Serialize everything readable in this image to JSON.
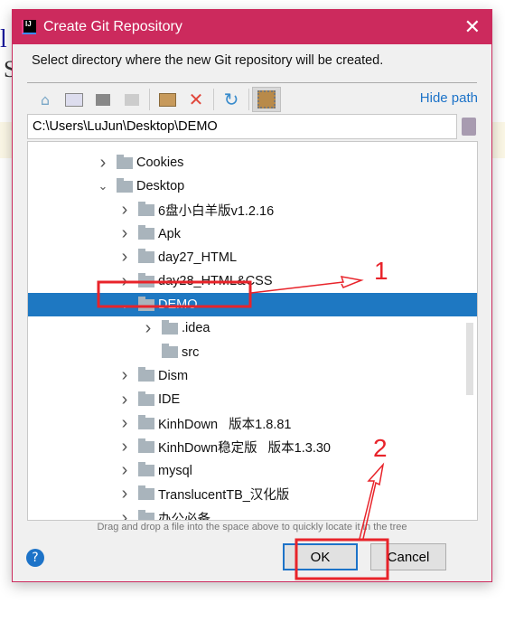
{
  "window": {
    "title": "Create Git Repository",
    "description": "Select directory where the new Git repository will be created."
  },
  "toolbar": {
    "icons": [
      "home-icon",
      "desktop-icon",
      "project-folder-icon",
      "module-folder-icon",
      "new-folder-icon",
      "delete-icon",
      "refresh-icon",
      "show-hidden-icon"
    ],
    "hide_path": "Hide path"
  },
  "path": {
    "value": "C:\\Users\\LuJun\\Desktop\\DEMO"
  },
  "tree": [
    {
      "label": "Cookies",
      "level": 1,
      "expanded": false,
      "has_children": true
    },
    {
      "label": "Desktop",
      "level": 1,
      "expanded": true,
      "has_children": true
    },
    {
      "label": "6盘小白羊版v1.2.16",
      "level": 2,
      "expanded": false,
      "has_children": true
    },
    {
      "label": "Apk",
      "level": 2,
      "expanded": false,
      "has_children": true
    },
    {
      "label": "day27_HTML",
      "level": 2,
      "expanded": false,
      "has_children": true
    },
    {
      "label": "day28_HTML&CSS",
      "level": 2,
      "expanded": false,
      "has_children": true
    },
    {
      "label": "DEMO",
      "level": 2,
      "expanded": true,
      "has_children": true,
      "selected": true
    },
    {
      "label": ".idea",
      "level": 3,
      "expanded": false,
      "has_children": true
    },
    {
      "label": "src",
      "level": 3,
      "expanded": false,
      "has_children": false
    },
    {
      "label": "Dism",
      "level": 2,
      "expanded": false,
      "has_children": true
    },
    {
      "label": "IDE",
      "level": 2,
      "expanded": false,
      "has_children": true
    },
    {
      "label": "KinhDown   版本1.8.81",
      "level": 2,
      "expanded": false,
      "has_children": true
    },
    {
      "label": "KinhDown稳定版   版本1.3.30",
      "level": 2,
      "expanded": false,
      "has_children": true
    },
    {
      "label": "mysql",
      "level": 2,
      "expanded": false,
      "has_children": true
    },
    {
      "label": "TranslucentTB_汉化版",
      "level": 2,
      "expanded": false,
      "has_children": true
    },
    {
      "label": "办公必备",
      "level": 2,
      "expanded": false,
      "has_children": true
    }
  ],
  "hint": "Drag and drop a file into the space above to quickly locate it in the tree",
  "buttons": {
    "help": "?",
    "ok": "OK",
    "cancel": "Cancel"
  },
  "annotations": {
    "step1": "1",
    "step2": "2",
    "color": "#e8232a"
  },
  "colors": {
    "titlebar": "#cc2a5d",
    "selection": "#1e78c2",
    "link": "#1d73c8"
  }
}
